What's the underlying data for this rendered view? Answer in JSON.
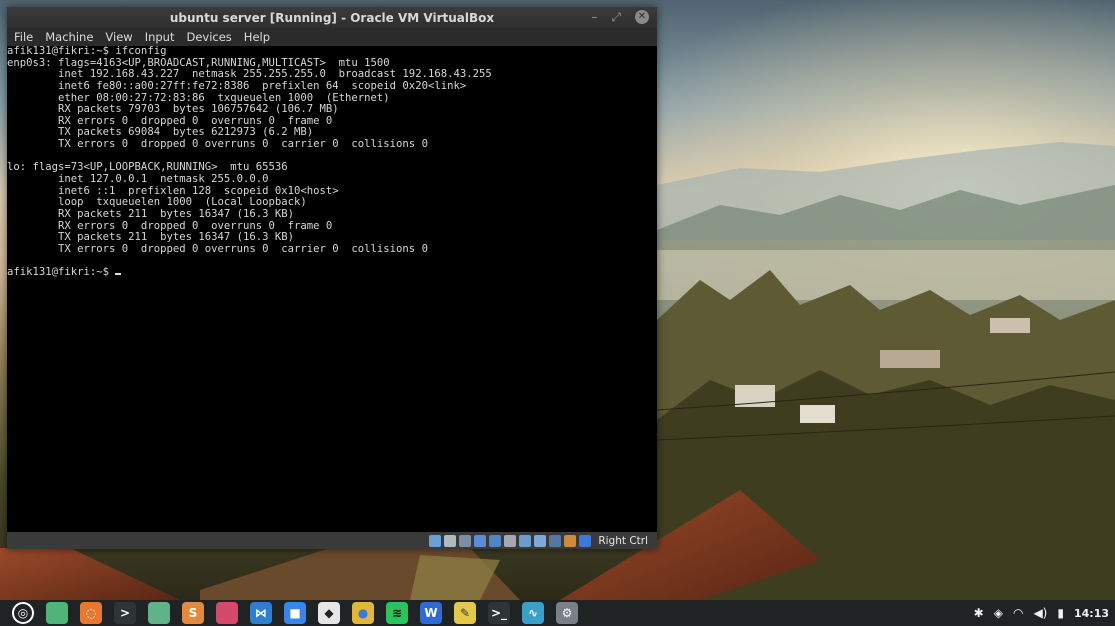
{
  "window": {
    "title": "ubuntu server [Running] - Oracle VM VirtualBox",
    "controls": {
      "minimize": "–",
      "maximize": "⤢",
      "close": "✕"
    }
  },
  "menu": [
    "File",
    "Machine",
    "View",
    "Input",
    "Devices",
    "Help"
  ],
  "terminal": {
    "lines": [
      "afik131@fikri:~$ ifconfig",
      "enp0s3: flags=4163<UP,BROADCAST,RUNNING,MULTICAST>  mtu 1500",
      "        inet 192.168.43.227  netmask 255.255.255.0  broadcast 192.168.43.255",
      "        inet6 fe80::a00:27ff:fe72:8386  prefixlen 64  scopeid 0x20<link>",
      "        ether 08:00:27:72:83:86  txqueuelen 1000  (Ethernet)",
      "        RX packets 79703  bytes 106757642 (106.7 MB)",
      "        RX errors 0  dropped 0  overruns 0  frame 0",
      "        TX packets 69084  bytes 6212973 (6.2 MB)",
      "        TX errors 0  dropped 0 overruns 0  carrier 0  collisions 0",
      "",
      "lo: flags=73<UP,LOOPBACK,RUNNING>  mtu 65536",
      "        inet 127.0.0.1  netmask 255.0.0.0",
      "        inet6 ::1  prefixlen 128  scopeid 0x10<host>",
      "        loop  txqueuelen 1000  (Local Loopback)",
      "        RX packets 211  bytes 16347 (16.3 KB)",
      "        RX errors 0  dropped 0  overruns 0  frame 0",
      "        TX packets 211  bytes 16347 (16.3 KB)",
      "        TX errors 0  dropped 0 overruns 0  carrier 0  collisions 0",
      "",
      "afik131@fikri:~$ "
    ]
  },
  "statusbar": {
    "icons": [
      {
        "name": "hard-disk-icon",
        "color": "#6aa0d8"
      },
      {
        "name": "optical-drive-icon",
        "color": "#b0b8c0"
      },
      {
        "name": "audio-icon",
        "color": "#7a8fa6"
      },
      {
        "name": "network-icon",
        "color": "#5b8ed6"
      },
      {
        "name": "usb-icon",
        "color": "#4f86c6"
      },
      {
        "name": "shared-folders-icon",
        "color": "#a3a9b0"
      },
      {
        "name": "display-icon",
        "color": "#6c9bd2"
      },
      {
        "name": "video-capture-icon",
        "color": "#7fa8d8"
      },
      {
        "name": "cpu-icon",
        "color": "#5677a0"
      },
      {
        "name": "mouse-integration-icon",
        "color": "#d08a3a"
      },
      {
        "name": "keyboard-icon",
        "color": "#3b7ad6"
      }
    ],
    "host_key": "Right Ctrl"
  },
  "taskbar": {
    "apps": [
      {
        "name": "menu-icon",
        "glyph": "◎",
        "color": "#1f2324",
        "fg": "#ffffff"
      },
      {
        "name": "files-icon",
        "glyph": "",
        "color": "#4fb37a",
        "fg": "#ffffff"
      },
      {
        "name": "ubuntu-icon",
        "glyph": "◌",
        "color": "#e8782f",
        "fg": "#ffffff"
      },
      {
        "name": "terminal-icon",
        "glyph": ">",
        "color": "#2f3436",
        "fg": "#ffffff"
      },
      {
        "name": "folder-icon",
        "glyph": "",
        "color": "#5fb38a",
        "fg": "#ffffff"
      },
      {
        "name": "sublime-icon",
        "glyph": "S",
        "color": "#e48a3e",
        "fg": "#ffffff"
      },
      {
        "name": "slack-icon",
        "glyph": "",
        "color": "#d44a6a",
        "fg": "#ffffff"
      },
      {
        "name": "vscode-icon",
        "glyph": "⋈",
        "color": "#2f7fd0",
        "fg": "#ffffff"
      },
      {
        "name": "zoom-icon",
        "glyph": "■",
        "color": "#3a86e8",
        "fg": "#ffffff"
      },
      {
        "name": "inkscape-icon",
        "glyph": "◆",
        "color": "#e6e6e6",
        "fg": "#222222"
      },
      {
        "name": "chrome-icon",
        "glyph": "●",
        "color": "#e3b63a",
        "fg": "#3a7bd5"
      },
      {
        "name": "spotify-icon",
        "glyph": "≋",
        "color": "#2cc35d",
        "fg": "#111111"
      },
      {
        "name": "wps-icon",
        "glyph": "W",
        "color": "#2f6bd6",
        "fg": "#ffffff"
      },
      {
        "name": "notes-icon",
        "glyph": "✎",
        "color": "#e3c84a",
        "fg": "#3a3a3a"
      },
      {
        "name": "terminal2-icon",
        "glyph": ">_",
        "color": "#2f3436",
        "fg": "#ffffff"
      },
      {
        "name": "monitor-icon",
        "glyph": "∿",
        "color": "#3ba0c9",
        "fg": "#ffffff"
      },
      {
        "name": "settings-icon",
        "glyph": "⚙",
        "color": "#7a8088",
        "fg": "#ffffff"
      }
    ],
    "tray": {
      "bluetooth": "✱",
      "shield": "◈",
      "wifi": "◠",
      "volume": "◀)",
      "battery": "▮",
      "clock": "14:13"
    }
  }
}
